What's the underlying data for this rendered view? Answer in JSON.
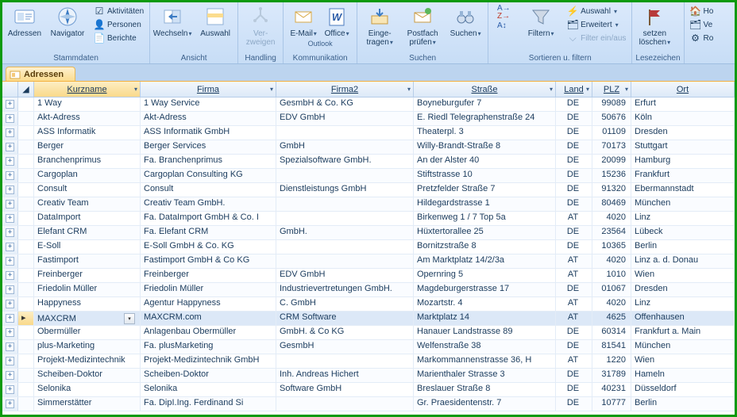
{
  "ribbon": {
    "groups": [
      {
        "label": "Stammdaten",
        "big": [
          {
            "name": "adressen-btn",
            "label": "Adressen"
          },
          {
            "name": "navigator-btn",
            "label": "Navigator"
          }
        ],
        "small": [
          {
            "name": "aktivitaeten-btn",
            "label": "Aktivitäten"
          },
          {
            "name": "personen-btn",
            "label": "Personen"
          },
          {
            "name": "berichte-btn",
            "label": "Berichte"
          }
        ]
      },
      {
        "label": "Ansicht",
        "big": [
          {
            "name": "wechseln-btn",
            "label": "Wechseln"
          },
          {
            "name": "auswahl-btn",
            "label": "Auswahl"
          }
        ]
      },
      {
        "label": "Handling",
        "big": [
          {
            "name": "verzweigen-btn",
            "label": "Ver-\nzweigen",
            "dim": true
          }
        ]
      },
      {
        "label": "Kommunikation",
        "big": [
          {
            "name": "email-btn",
            "label": "E-Mail"
          },
          {
            "name": "office-btn",
            "label": "Office"
          }
        ],
        "sublabel": "Outlook"
      },
      {
        "label": "Suchen",
        "big": [
          {
            "name": "eingetragen-btn",
            "label": "Einge-\ntragen"
          },
          {
            "name": "postfach-btn",
            "label": "Postfach\nprüfen"
          },
          {
            "name": "suchen-btn",
            "label": "Suchen"
          }
        ]
      },
      {
        "label": "Sortieren u. filtern",
        "big": [
          {
            "name": "sort-btn",
            "label": ""
          },
          {
            "name": "filtern-btn",
            "label": "Filtern"
          }
        ],
        "small": [
          {
            "name": "auswahl-filter-btn",
            "label": "Auswahl"
          },
          {
            "name": "erweitert-btn",
            "label": "Erweitert"
          },
          {
            "name": "filter-toggle-btn",
            "label": "Filter ein/aus",
            "dim": true
          }
        ]
      },
      {
        "label": "Lesezeichen",
        "big": [
          {
            "name": "setzen-loeschen-btn",
            "label": "setzen\nlöschen"
          }
        ]
      }
    ],
    "rightSmall": [
      {
        "name": "home-btn",
        "label": "Ho"
      },
      {
        "name": "ve-btn",
        "label": "Ve"
      },
      {
        "name": "ro-btn",
        "label": "Ro"
      }
    ]
  },
  "tab": {
    "label": "Adressen"
  },
  "columns": [
    "",
    "",
    "Kurzname",
    "Firma",
    "Firma2",
    "Straße",
    "Land",
    "PLZ",
    "Ort"
  ],
  "rows": [
    [
      "1 Way",
      "1 Way Service",
      "GesmbH & Co. KG",
      "Boyneburgufer 7",
      "DE",
      "99089",
      "Erfurt"
    ],
    [
      "Akt-Adress",
      "Akt-Adress",
      "EDV GmbH",
      "E. Riedl Telegraphenstraße 24",
      "DE",
      "50676",
      "Köln"
    ],
    [
      "ASS Informatik",
      "ASS Informatik GmbH",
      "",
      "Theaterpl. 3",
      "DE",
      "01109",
      "Dresden"
    ],
    [
      "Berger",
      "Berger Services",
      "GmbH",
      "Willy-Brandt-Straße 8",
      "DE",
      "70173",
      "Stuttgart"
    ],
    [
      "Branchenprimus",
      "Fa. Branchenprimus",
      "Spezialsoftware GmbH.",
      "An der Alster 40",
      "DE",
      "20099",
      "Hamburg"
    ],
    [
      "Cargoplan",
      "Cargoplan Consulting KG",
      "",
      "Stiftstrasse 10",
      "DE",
      "15236",
      "Frankfurt"
    ],
    [
      "Consult",
      "Consult",
      "Dienstleistungs GmbH",
      "Pretzfelder Straße 7",
      "DE",
      "91320",
      "Ebermannstadt"
    ],
    [
      "Creativ Team",
      "Creativ Team GmbH.",
      "",
      "Hildegardstrasse 1",
      "DE",
      "80469",
      "München"
    ],
    [
      "DataImport",
      "Fa. DataImport GmbH & Co. I",
      "",
      "Birkenweg 1 / 7 Top 5a",
      "AT",
      "4020",
      "Linz"
    ],
    [
      "Elefant CRM",
      "Fa. Elefant CRM",
      "GmbH.",
      "Hüxtertorallee 25",
      "DE",
      "23564",
      "Lübeck"
    ],
    [
      "E-Soll",
      "E-Soll GmbH & Co. KG",
      "",
      "Bornitzstraße 8",
      "DE",
      "10365",
      "Berlin"
    ],
    [
      "Fastimport",
      "Fastimport GmbH & Co KG",
      "",
      "Am Marktplatz 14/2/3a",
      "AT",
      "4020",
      "Linz a. d. Donau"
    ],
    [
      "Freinberger",
      "Freinberger",
      "EDV GmbH",
      "Opernring 5",
      "AT",
      "1010",
      "Wien"
    ],
    [
      "Friedolin Müller",
      "Friedolin Müller",
      "Industrievertretungen GmbH.",
      "Magdeburgerstrasse 17",
      "DE",
      "01067",
      "Dresden"
    ],
    [
      "Happyness",
      "Agentur Happyness",
      "C. GmbH",
      "Mozartstr. 4",
      "AT",
      "4020",
      "Linz"
    ],
    [
      "MAXCRM",
      "MAXCRM.com",
      "CRM Software",
      "Marktplatz 14",
      "AT",
      "4625",
      "Offenhausen"
    ],
    [
      "Obermüller",
      "Anlagenbau Obermüller",
      "GmbH. & Co KG",
      "Hanauer Landstrasse 89",
      "DE",
      "60314",
      "Frankfurt a. Main"
    ],
    [
      "plus-Marketing",
      "Fa. plusMarketing",
      "GesmbH",
      "Welfenstraße 38",
      "DE",
      "81541",
      "München"
    ],
    [
      "Projekt-Medizintechnik",
      "Projekt-Medizintechnik GmbH",
      "",
      "Markommannenstrasse 36, H",
      "AT",
      "1220",
      "Wien"
    ],
    [
      "Scheiben-Doktor",
      "Scheiben-Doktor",
      "Inh. Andreas Hichert",
      "Marienthaler Strasse 3",
      "DE",
      "31789",
      "Hameln"
    ],
    [
      "Selonika",
      "Selonika",
      "Software GmbH",
      "Breslauer Straße 8",
      "DE",
      "40231",
      "Düsseldorf"
    ],
    [
      "Simmerstätter",
      "Fa. DipI.Ing. Ferdinand Si",
      "",
      "Gr. Praesidentenstr. 7",
      "DE",
      "10777",
      "Berlin"
    ]
  ],
  "selectedRow": 15
}
